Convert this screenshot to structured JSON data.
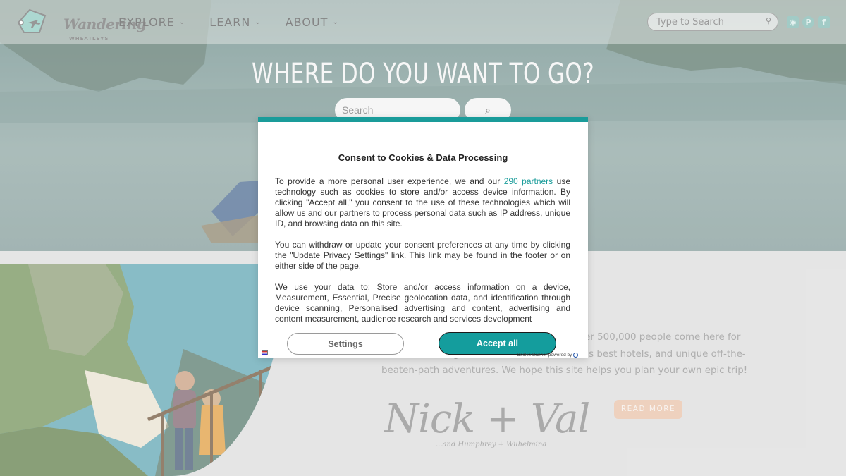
{
  "header": {
    "logo_word": "Wandering",
    "logo_sub": "WHEATLEYS",
    "nav": [
      {
        "label": "EXPLORE"
      },
      {
        "label": "LEARN"
      },
      {
        "label": "ABOUT"
      }
    ],
    "search_placeholder": "Type to Search",
    "social_icons": [
      "instagram-icon",
      "pinterest-icon",
      "facebook-icon"
    ]
  },
  "hero": {
    "title": "WHERE DO YOU WANT TO GO?",
    "search_placeholder": "Search",
    "search_button": "⌕"
  },
  "about": {
    "text": "k in 2013 as a way to share our / month over 500,000 people come here for detailed travel guides, reviews of the world's best hotels, and unique off-the-beaten-path adventures. We hope this site helps you plan your own epic trip!",
    "read_more": "READ MORE",
    "signature": "Nick + Val",
    "signature_sub": "...and Humphrey + Wilhelmina"
  },
  "consent": {
    "title": "Consent to Cookies & Data Processing",
    "p1_before": "To provide a more personal user experience, we and our ",
    "p1_link": "290 partners",
    "p1_after": " use technology such as cookies to store and/or access device information. By clicking \"Accept all,\" you consent to the use of these technologies which will allow us and our partners to process personal data such as IP address, unique ID, and browsing data on this site.",
    "p2": "You can withdraw or update your consent preferences at any time by clicking the \"Update Privacy Settings\" link. This link may be found in the footer or on either side of the page.",
    "p3": "We use your data to: Store and/or access information on a device, Measurement, Essential, Precise geolocation data, and identification through device scanning, Personalised advertising and content, advertising and content measurement, audience research and services development",
    "settings_label": "Settings",
    "accept_label": "Accept all",
    "powered_by": "Cookie Banner powered by",
    "accent_color": "#1a9c9a"
  }
}
